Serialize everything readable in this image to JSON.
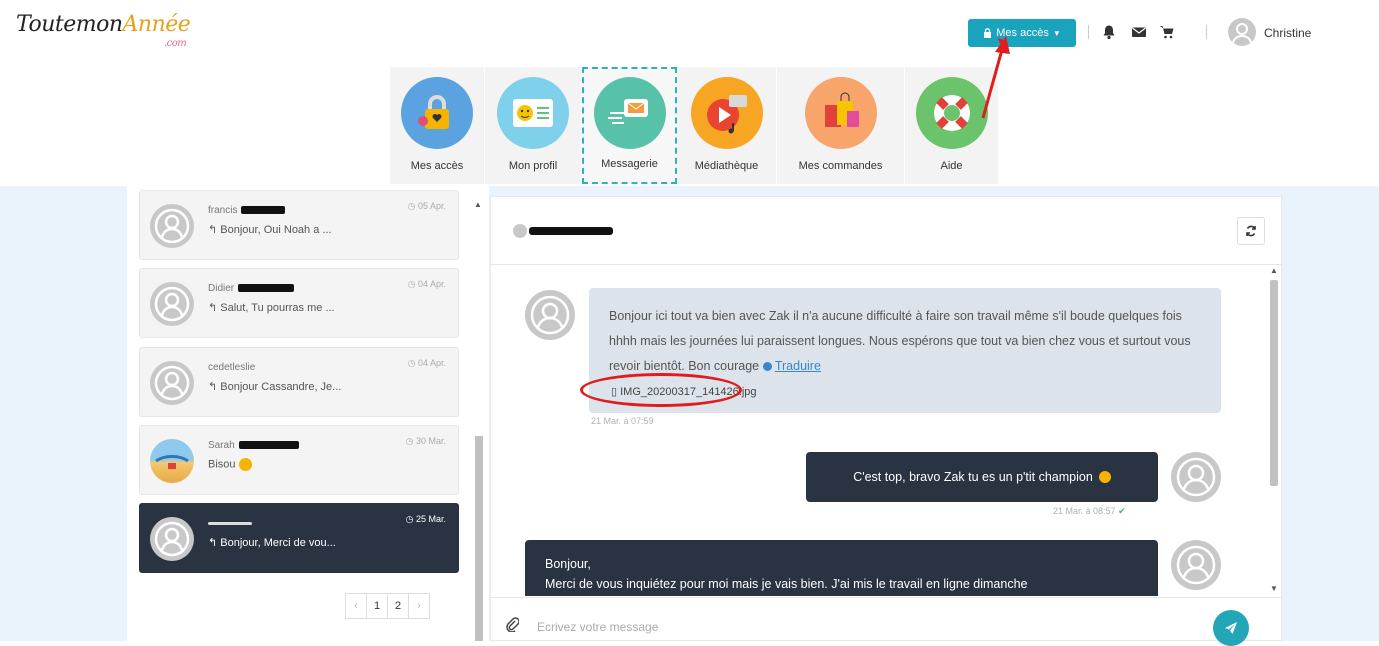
{
  "header": {
    "logo_main": "ToutemonAnnée",
    "logo_part1": "Toutemon",
    "logo_part2": "Année",
    "logo_sub": ".com",
    "acces_button": "Mes accès",
    "user_name": "Christine",
    "icons": [
      "lock-icon",
      "bell-icon",
      "envelope-icon",
      "cart-icon",
      "user-avatar-icon"
    ]
  },
  "tiles": [
    {
      "label": "Mes accès",
      "color": "#5aa3e0"
    },
    {
      "label": "Mon profil",
      "color": "#7fd0ea"
    },
    {
      "label": "Messagerie",
      "color": "#58c2a8"
    },
    {
      "label": "Médiathèque",
      "color": "#f6a623"
    },
    {
      "label": "Mes commandes",
      "color": "#f7a56b"
    },
    {
      "label": "Aide",
      "color": "#6bc36b"
    }
  ],
  "conversations": [
    {
      "name": "francis",
      "date": "05 Apr.",
      "preview": "Bonjour, Oui Noah a ..."
    },
    {
      "name": "Didier",
      "date": "04 Apr.",
      "preview": "Salut, Tu pourras me ..."
    },
    {
      "name": "cedetleslie",
      "date": "04 Apr.",
      "preview": "Bonjour Cassandre, Je..."
    },
    {
      "name": "Sarah",
      "date": "30 Mar.",
      "preview": "Bisou"
    },
    {
      "name": "",
      "date": "25 Mar.",
      "preview": "Bonjour, Merci de vou..."
    }
  ],
  "pager": {
    "prev": "‹",
    "pages": [
      "1",
      "2"
    ],
    "next": "›"
  },
  "messages": {
    "incoming_text": "Bonjour ici tout va bien avec Zak il n'a aucune difficulté à faire son travail même s'il boude quelques fois hhhh mais les journées lui paraissent longues. Nous espérons que tout va bien chez vous et surtout vous revoir bientôt. Bon courage",
    "translate_link": "Traduire",
    "attachment": "IMG_20200317_141426.jpg",
    "incoming_time": "21 Mar. à 07:59",
    "outgoing_text": "C'est top, bravo Zak tu es un p'tit champion",
    "outgoing_time": "21 Mar. à 08:57",
    "outgoing2_line1": "Bonjour,",
    "outgoing2_line2": "Merci de vous inquiétez pour moi mais je vais bien. J'ai mis le travail en ligne dimanche"
  },
  "compose": {
    "placeholder": "Ecrivez votre message"
  },
  "colors": {
    "accent": "#1aa3bd",
    "dark": "#293341",
    "annotation": "#e01c1c"
  }
}
